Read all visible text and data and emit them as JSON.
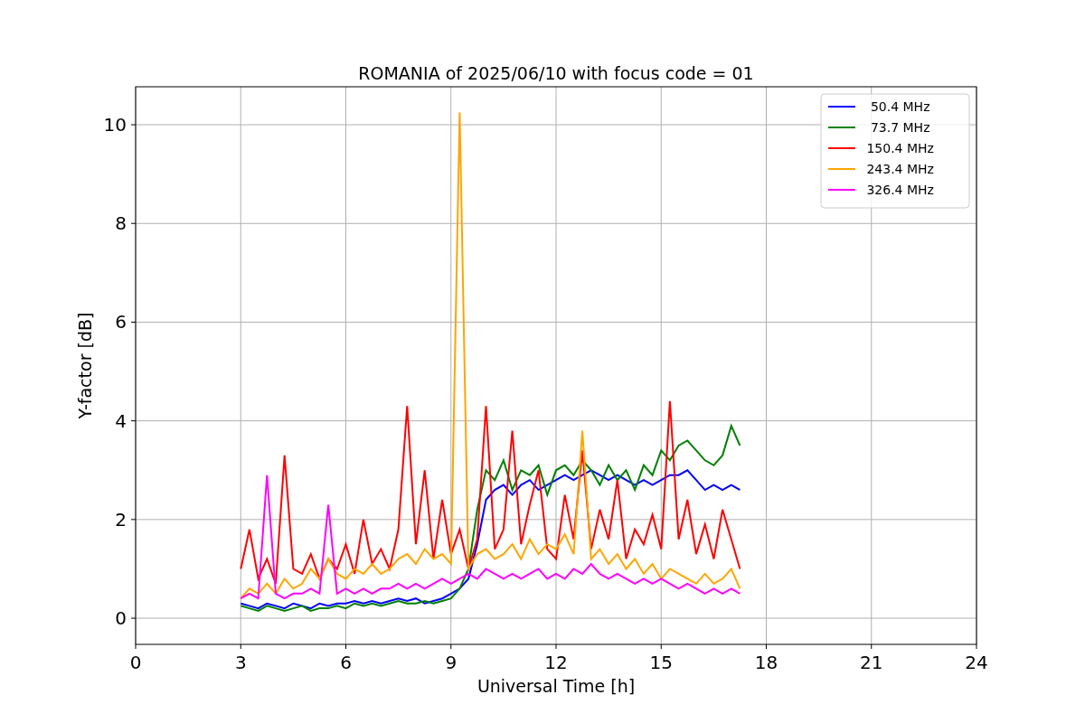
{
  "chart_data": {
    "type": "line",
    "title": "ROMANIA of 2025/06/10 with focus code = 01",
    "xlabel": "Universal Time [h]",
    "ylabel": "Y-factor [dB]",
    "xlim": [
      0,
      24
    ],
    "ylim": [
      -0.53,
      10.77
    ],
    "xticks": [
      0,
      3,
      6,
      9,
      12,
      15,
      18,
      21,
      24
    ],
    "yticks": [
      0,
      2,
      4,
      6,
      8,
      10
    ],
    "grid": true,
    "legend": true,
    "x": [
      3,
      3.25,
      3.5,
      3.75,
      4,
      4.25,
      4.5,
      4.75,
      5,
      5.25,
      5.5,
      5.75,
      6,
      6.25,
      6.5,
      6.75,
      7,
      7.25,
      7.5,
      7.75,
      8,
      8.25,
      8.5,
      8.75,
      9,
      9.25,
      9.5,
      9.75,
      10,
      10.25,
      10.5,
      10.75,
      11,
      11.25,
      11.5,
      11.75,
      12,
      12.25,
      12.5,
      12.75,
      13,
      13.25,
      13.5,
      13.75,
      14,
      14.25,
      14.5,
      14.75,
      15,
      15.25,
      15.5,
      15.75,
      16,
      16.25,
      16.5,
      16.75,
      17,
      17.25
    ],
    "series": [
      {
        "name": "  50.4 MHz",
        "color": "#0000ff",
        "values": [
          0.3,
          0.25,
          0.2,
          0.3,
          0.25,
          0.2,
          0.3,
          0.25,
          0.2,
          0.3,
          0.25,
          0.3,
          0.3,
          0.35,
          0.3,
          0.35,
          0.3,
          0.35,
          0.4,
          0.35,
          0.4,
          0.3,
          0.35,
          0.4,
          0.5,
          0.6,
          0.8,
          1.5,
          2.4,
          2.6,
          2.7,
          2.5,
          2.7,
          2.8,
          2.6,
          2.7,
          2.8,
          2.9,
          2.8,
          2.9,
          3.0,
          2.9,
          2.8,
          2.9,
          2.8,
          2.7,
          2.8,
          2.7,
          2.8,
          2.9,
          2.9,
          3.0,
          2.8,
          2.6,
          2.7,
          2.6,
          2.7,
          2.6
        ]
      },
      {
        "name": "  73.7 MHz",
        "color": "#008000",
        "values": [
          0.25,
          0.2,
          0.15,
          0.25,
          0.2,
          0.15,
          0.2,
          0.25,
          0.15,
          0.2,
          0.2,
          0.25,
          0.2,
          0.3,
          0.25,
          0.3,
          0.25,
          0.3,
          0.35,
          0.3,
          0.3,
          0.35,
          0.3,
          0.35,
          0.4,
          0.6,
          1.0,
          2.2,
          3.0,
          2.8,
          3.2,
          2.6,
          3.0,
          2.9,
          3.1,
          2.5,
          3.0,
          3.1,
          2.9,
          3.2,
          3.0,
          2.7,
          3.1,
          2.8,
          3.0,
          2.6,
          3.1,
          2.9,
          3.4,
          3.2,
          3.5,
          3.6,
          3.4,
          3.2,
          3.1,
          3.3,
          3.9,
          3.5
        ]
      },
      {
        "name": " 150.4 MHz",
        "color": "#ff0000",
        "values": [
          1.0,
          1.8,
          0.8,
          1.2,
          0.7,
          3.3,
          1.0,
          0.9,
          1.3,
          0.8,
          1.2,
          1.0,
          1.5,
          0.9,
          2.0,
          1.1,
          1.4,
          1.0,
          1.8,
          4.3,
          1.5,
          3.0,
          1.2,
          2.4,
          1.3,
          1.8,
          1.0,
          1.6,
          4.3,
          1.4,
          1.8,
          3.8,
          1.5,
          2.3,
          3.0,
          1.4,
          1.2,
          2.5,
          1.6,
          3.4,
          1.4,
          2.2,
          1.6,
          2.8,
          1.2,
          1.8,
          1.5,
          2.1,
          1.4,
          4.4,
          1.6,
          2.4,
          1.3,
          1.9,
          1.2,
          2.2,
          1.6,
          1.0
        ]
      },
      {
        "name": " 243.4 MHz",
        "color": "#ffa500",
        "values": [
          0.4,
          0.6,
          0.5,
          0.7,
          0.5,
          0.8,
          0.6,
          0.7,
          1.0,
          0.8,
          1.2,
          0.9,
          0.8,
          1.0,
          0.9,
          1.1,
          0.9,
          1.0,
          1.2,
          1.3,
          1.1,
          1.4,
          1.2,
          1.3,
          1.1,
          10.25,
          1.0,
          1.3,
          1.4,
          1.2,
          1.3,
          1.5,
          1.2,
          1.6,
          1.3,
          1.5,
          1.4,
          1.7,
          1.3,
          3.8,
          1.2,
          1.4,
          1.1,
          1.3,
          1.0,
          1.2,
          0.9,
          1.1,
          0.8,
          1.0,
          0.9,
          0.8,
          0.7,
          0.9,
          0.7,
          0.8,
          1.0,
          0.6
        ]
      },
      {
        "name": " 326.4 MHz",
        "color": "#ff00ff",
        "values": [
          0.4,
          0.5,
          0.4,
          2.9,
          0.5,
          0.4,
          0.5,
          0.5,
          0.6,
          0.5,
          2.3,
          0.5,
          0.6,
          0.5,
          0.6,
          0.5,
          0.6,
          0.6,
          0.7,
          0.6,
          0.7,
          0.6,
          0.7,
          0.8,
          0.7,
          0.8,
          0.9,
          0.8,
          1.0,
          0.9,
          0.8,
          0.9,
          0.8,
          0.9,
          1.0,
          0.8,
          0.9,
          0.8,
          1.0,
          0.9,
          1.1,
          0.9,
          0.8,
          0.9,
          0.8,
          0.7,
          0.8,
          0.7,
          0.8,
          0.7,
          0.6,
          0.7,
          0.6,
          0.5,
          0.6,
          0.5,
          0.6,
          0.5
        ]
      }
    ]
  }
}
